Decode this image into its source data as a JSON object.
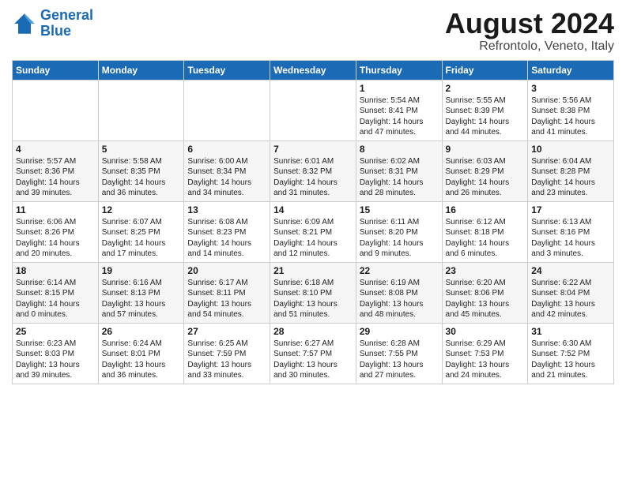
{
  "logo": {
    "line1": "General",
    "line2": "Blue"
  },
  "title": "August 2024",
  "subtitle": "Refrontolo, Veneto, Italy",
  "weekdays": [
    "Sunday",
    "Monday",
    "Tuesday",
    "Wednesday",
    "Thursday",
    "Friday",
    "Saturday"
  ],
  "weeks": [
    [
      {
        "day": "",
        "info": ""
      },
      {
        "day": "",
        "info": ""
      },
      {
        "day": "",
        "info": ""
      },
      {
        "day": "",
        "info": ""
      },
      {
        "day": "1",
        "info": "Sunrise: 5:54 AM\nSunset: 8:41 PM\nDaylight: 14 hours\nand 47 minutes."
      },
      {
        "day": "2",
        "info": "Sunrise: 5:55 AM\nSunset: 8:39 PM\nDaylight: 14 hours\nand 44 minutes."
      },
      {
        "day": "3",
        "info": "Sunrise: 5:56 AM\nSunset: 8:38 PM\nDaylight: 14 hours\nand 41 minutes."
      }
    ],
    [
      {
        "day": "4",
        "info": "Sunrise: 5:57 AM\nSunset: 8:36 PM\nDaylight: 14 hours\nand 39 minutes."
      },
      {
        "day": "5",
        "info": "Sunrise: 5:58 AM\nSunset: 8:35 PM\nDaylight: 14 hours\nand 36 minutes."
      },
      {
        "day": "6",
        "info": "Sunrise: 6:00 AM\nSunset: 8:34 PM\nDaylight: 14 hours\nand 34 minutes."
      },
      {
        "day": "7",
        "info": "Sunrise: 6:01 AM\nSunset: 8:32 PM\nDaylight: 14 hours\nand 31 minutes."
      },
      {
        "day": "8",
        "info": "Sunrise: 6:02 AM\nSunset: 8:31 PM\nDaylight: 14 hours\nand 28 minutes."
      },
      {
        "day": "9",
        "info": "Sunrise: 6:03 AM\nSunset: 8:29 PM\nDaylight: 14 hours\nand 26 minutes."
      },
      {
        "day": "10",
        "info": "Sunrise: 6:04 AM\nSunset: 8:28 PM\nDaylight: 14 hours\nand 23 minutes."
      }
    ],
    [
      {
        "day": "11",
        "info": "Sunrise: 6:06 AM\nSunset: 8:26 PM\nDaylight: 14 hours\nand 20 minutes."
      },
      {
        "day": "12",
        "info": "Sunrise: 6:07 AM\nSunset: 8:25 PM\nDaylight: 14 hours\nand 17 minutes."
      },
      {
        "day": "13",
        "info": "Sunrise: 6:08 AM\nSunset: 8:23 PM\nDaylight: 14 hours\nand 14 minutes."
      },
      {
        "day": "14",
        "info": "Sunrise: 6:09 AM\nSunset: 8:21 PM\nDaylight: 14 hours\nand 12 minutes."
      },
      {
        "day": "15",
        "info": "Sunrise: 6:11 AM\nSunset: 8:20 PM\nDaylight: 14 hours\nand 9 minutes."
      },
      {
        "day": "16",
        "info": "Sunrise: 6:12 AM\nSunset: 8:18 PM\nDaylight: 14 hours\nand 6 minutes."
      },
      {
        "day": "17",
        "info": "Sunrise: 6:13 AM\nSunset: 8:16 PM\nDaylight: 14 hours\nand 3 minutes."
      }
    ],
    [
      {
        "day": "18",
        "info": "Sunrise: 6:14 AM\nSunset: 8:15 PM\nDaylight: 14 hours\nand 0 minutes."
      },
      {
        "day": "19",
        "info": "Sunrise: 6:16 AM\nSunset: 8:13 PM\nDaylight: 13 hours\nand 57 minutes."
      },
      {
        "day": "20",
        "info": "Sunrise: 6:17 AM\nSunset: 8:11 PM\nDaylight: 13 hours\nand 54 minutes."
      },
      {
        "day": "21",
        "info": "Sunrise: 6:18 AM\nSunset: 8:10 PM\nDaylight: 13 hours\nand 51 minutes."
      },
      {
        "day": "22",
        "info": "Sunrise: 6:19 AM\nSunset: 8:08 PM\nDaylight: 13 hours\nand 48 minutes."
      },
      {
        "day": "23",
        "info": "Sunrise: 6:20 AM\nSunset: 8:06 PM\nDaylight: 13 hours\nand 45 minutes."
      },
      {
        "day": "24",
        "info": "Sunrise: 6:22 AM\nSunset: 8:04 PM\nDaylight: 13 hours\nand 42 minutes."
      }
    ],
    [
      {
        "day": "25",
        "info": "Sunrise: 6:23 AM\nSunset: 8:03 PM\nDaylight: 13 hours\nand 39 minutes."
      },
      {
        "day": "26",
        "info": "Sunrise: 6:24 AM\nSunset: 8:01 PM\nDaylight: 13 hours\nand 36 minutes."
      },
      {
        "day": "27",
        "info": "Sunrise: 6:25 AM\nSunset: 7:59 PM\nDaylight: 13 hours\nand 33 minutes."
      },
      {
        "day": "28",
        "info": "Sunrise: 6:27 AM\nSunset: 7:57 PM\nDaylight: 13 hours\nand 30 minutes."
      },
      {
        "day": "29",
        "info": "Sunrise: 6:28 AM\nSunset: 7:55 PM\nDaylight: 13 hours\nand 27 minutes."
      },
      {
        "day": "30",
        "info": "Sunrise: 6:29 AM\nSunset: 7:53 PM\nDaylight: 13 hours\nand 24 minutes."
      },
      {
        "day": "31",
        "info": "Sunrise: 6:30 AM\nSunset: 7:52 PM\nDaylight: 13 hours\nand 21 minutes."
      }
    ]
  ]
}
